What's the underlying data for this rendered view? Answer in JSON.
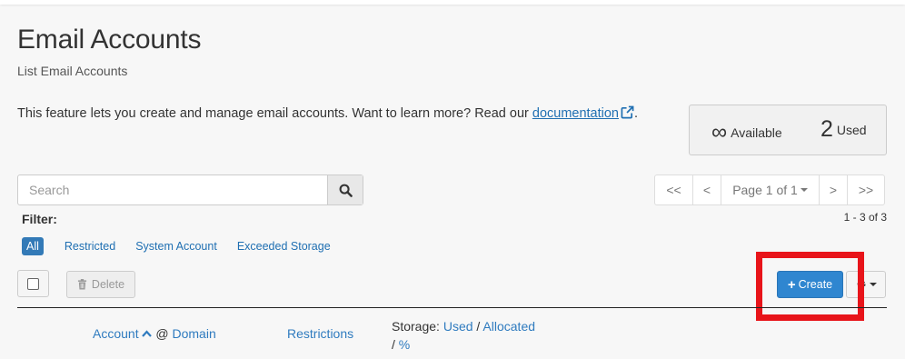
{
  "page": {
    "title": "Email Accounts",
    "subtitle": "List Email Accounts"
  },
  "intro": {
    "text": "This feature lets you create and manage email accounts. Want to learn more? Read our ",
    "link": "documentation",
    "suffix": "."
  },
  "stats": {
    "available_value": "∞",
    "available_label": "Available",
    "used_value": "2",
    "used_label": "Used"
  },
  "search": {
    "placeholder": "Search",
    "icon": "search-icon"
  },
  "pagination": {
    "first": "<<",
    "prev": "<",
    "page_label": "Page 1 of 1",
    "next": ">",
    "last": ">>",
    "range": "1 - 3 of 3"
  },
  "filter": {
    "label": "Filter:",
    "options": [
      "All",
      "Restricted",
      "System Account",
      "Exceeded Storage"
    ],
    "selected": "All"
  },
  "actions": {
    "delete_label": "Delete",
    "create_label": "Create"
  },
  "table": {
    "account": "Account",
    "at": "@",
    "domain": "Domain",
    "restrictions": "Restrictions",
    "storage_prefix": "Storage:",
    "used": "Used",
    "sep1": "/",
    "allocated": "Allocated",
    "sep2": "/",
    "percent": "%"
  },
  "colors": {
    "accent": "#2f86d0",
    "link": "#1f6fb2",
    "highlight": "#e8141a"
  }
}
